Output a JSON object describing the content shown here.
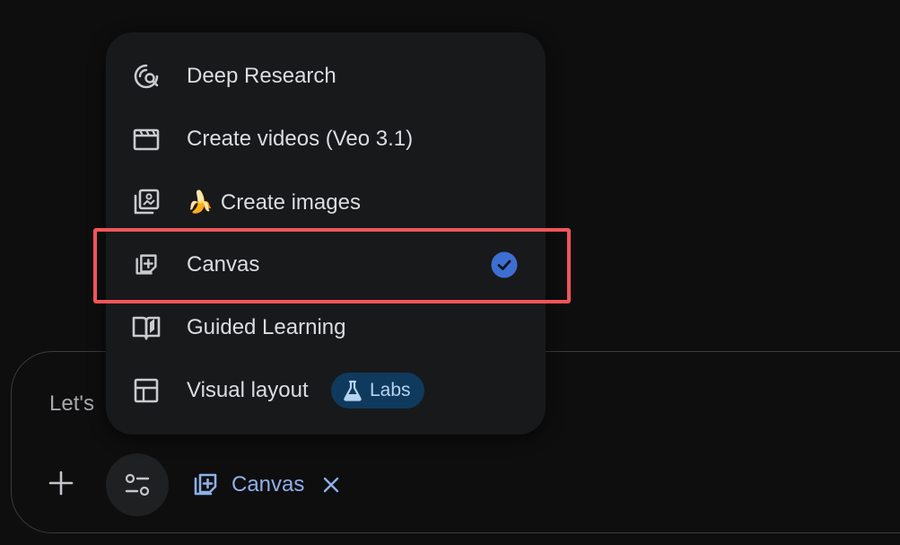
{
  "prompt": {
    "placeholder_visible": "Let's"
  },
  "menu": {
    "items": [
      {
        "label": "Deep Research",
        "icon": "deep-research-icon"
      },
      {
        "label": "Create videos (Veo 3.1)",
        "icon": "video-icon"
      },
      {
        "label": "Create images",
        "icon": "image-icon",
        "emoji": "🍌"
      },
      {
        "label": "Canvas",
        "icon": "canvas-icon",
        "selected": true
      },
      {
        "label": "Guided Learning",
        "icon": "book-icon"
      },
      {
        "label": "Visual layout",
        "icon": "layout-icon",
        "badge": "Labs"
      }
    ]
  },
  "toolbar": {
    "active_chip_label": "Canvas"
  },
  "colors": {
    "accent_blue": "#8fb0e8",
    "check_blue": "#3d6fd1",
    "highlight_red": "#f2555a",
    "menu_bg": "#18191b",
    "page_bg": "#0e0e0f"
  }
}
